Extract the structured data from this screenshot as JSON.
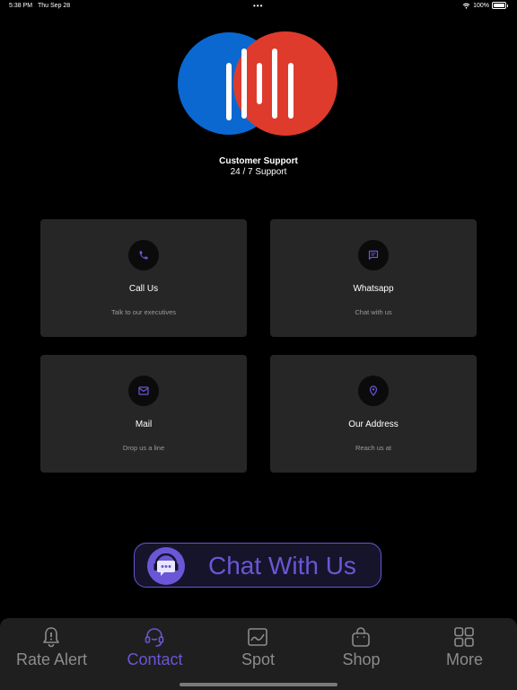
{
  "status_bar": {
    "time": "5:38 PM",
    "date": "Thu Sep 28",
    "dots": "•••",
    "battery": "100%"
  },
  "logo": {
    "blue": "#0b68d0",
    "red": "#de3b2c"
  },
  "header": {
    "title": "Customer Support",
    "subtitle": "24 / 7 Support"
  },
  "cards": [
    {
      "title": "Call Us",
      "subtitle": "Talk to our executives",
      "icon": "phone-icon"
    },
    {
      "title": "Whatsapp",
      "subtitle": "Chat with us",
      "icon": "message-icon"
    },
    {
      "title": "Mail",
      "subtitle": "Drop us a line",
      "icon": "mail-icon"
    },
    {
      "title": "Our Address",
      "subtitle": "Reach us at",
      "icon": "location-pin-icon"
    }
  ],
  "chat_button": {
    "label": "Chat With Us",
    "icon": "chat-support-icon"
  },
  "tabbar": {
    "active": "Contact",
    "accent": "#6a56d6",
    "items": [
      {
        "label": "Rate Alert",
        "icon": "bell-alert-icon"
      },
      {
        "label": "Contact",
        "icon": "headset-icon"
      },
      {
        "label": "Spot",
        "icon": "chart-icon"
      },
      {
        "label": "Shop",
        "icon": "shopping-bag-icon"
      },
      {
        "label": "More",
        "icon": "grid-icon"
      }
    ]
  }
}
